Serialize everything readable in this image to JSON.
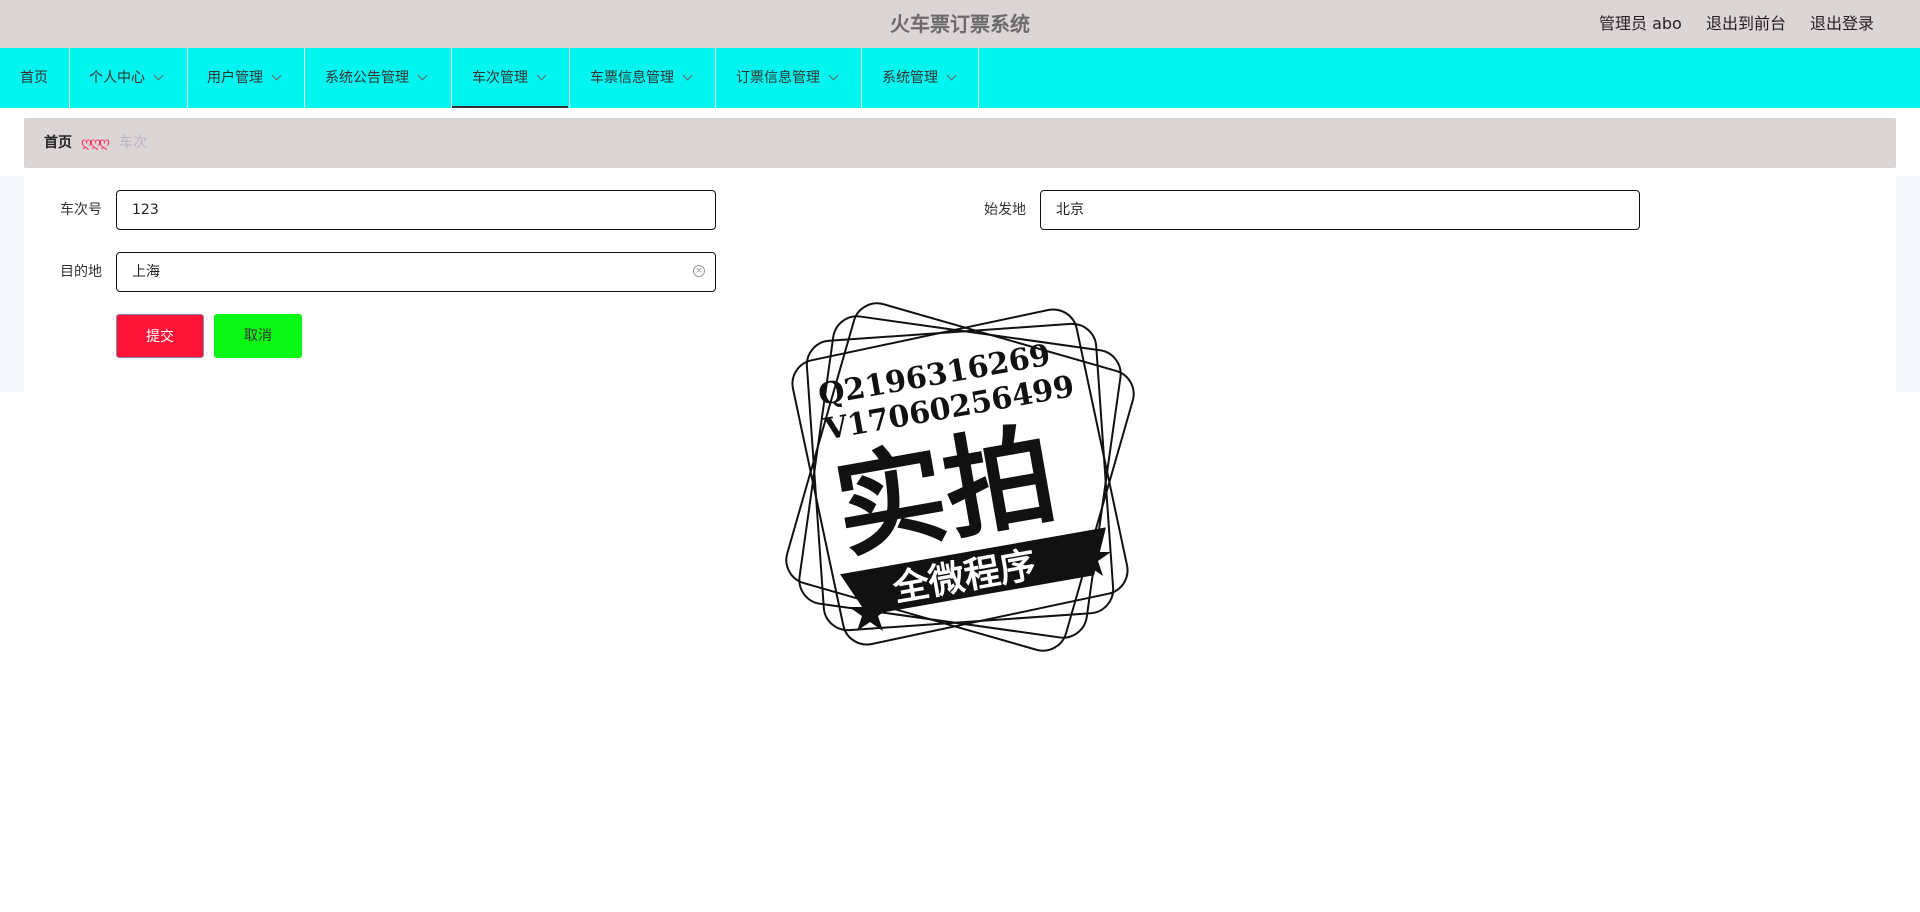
{
  "header": {
    "title": "火车票订票系统",
    "admin_label": "管理员 abo",
    "back_front_label": "退出到前台",
    "logout_label": "退出登录"
  },
  "nav": {
    "items": [
      {
        "label": "首页"
      },
      {
        "label": "个人中心"
      },
      {
        "label": "用户管理"
      },
      {
        "label": "系统公告管理"
      },
      {
        "label": "车次管理",
        "active": true
      },
      {
        "label": "车票信息管理"
      },
      {
        "label": "订票信息管理"
      },
      {
        "label": "系统管理"
      }
    ]
  },
  "breadcrumb": {
    "home": "首页",
    "separator": "ღღღ",
    "current": "车次"
  },
  "form": {
    "train_no_label": "车次号",
    "train_no_value": "123",
    "origin_label": "始发地",
    "origin_value": "北京",
    "destination_label": "目的地",
    "destination_value": "上海",
    "submit_label": "提交",
    "cancel_label": "取消"
  },
  "watermark": {
    "line1": "Q2196316269",
    "line2": "V17060256499",
    "main": "实拍",
    "banner": "全微程序"
  },
  "colors": {
    "header_bg": "#dbd5d5",
    "nav_bg": "#02f5ef",
    "submit_bg": "#ff1439",
    "cancel_bg": "#0af714"
  }
}
